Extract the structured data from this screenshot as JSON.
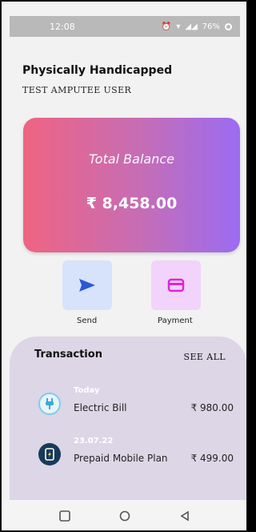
{
  "status_bar": {
    "time": "12:08",
    "battery_text": "76%"
  },
  "header": {
    "title": "Physically Handicapped",
    "subtitle": "TEST AMPUTEE USER"
  },
  "balance": {
    "label": "Total Balance",
    "amount": "₹ 8,458.00"
  },
  "actions": [
    {
      "label": "Send",
      "icon": "send-icon"
    },
    {
      "label": "Payment",
      "icon": "card-icon"
    }
  ],
  "transactions": {
    "title": "Transaction",
    "see_all": "SEE ALL",
    "items": [
      {
        "date": "Today",
        "name": "Electric Bill",
        "amount": "₹ 980.00",
        "icon": "plug-icon"
      },
      {
        "date": "23.07.22",
        "name": "Prepaid Mobile Plan",
        "amount": "₹ 499.00",
        "icon": "mobile-icon"
      }
    ]
  },
  "nav": [
    "square-icon",
    "circle-icon",
    "back-triangle-icon"
  ],
  "colors": {
    "card_gradient_start": "#ef6482",
    "card_gradient_end": "#9b6cf2",
    "send_bg": "#d7e3fb",
    "payment_bg": "#f2d3fb",
    "sheet_bg": "#dcd6e6"
  }
}
